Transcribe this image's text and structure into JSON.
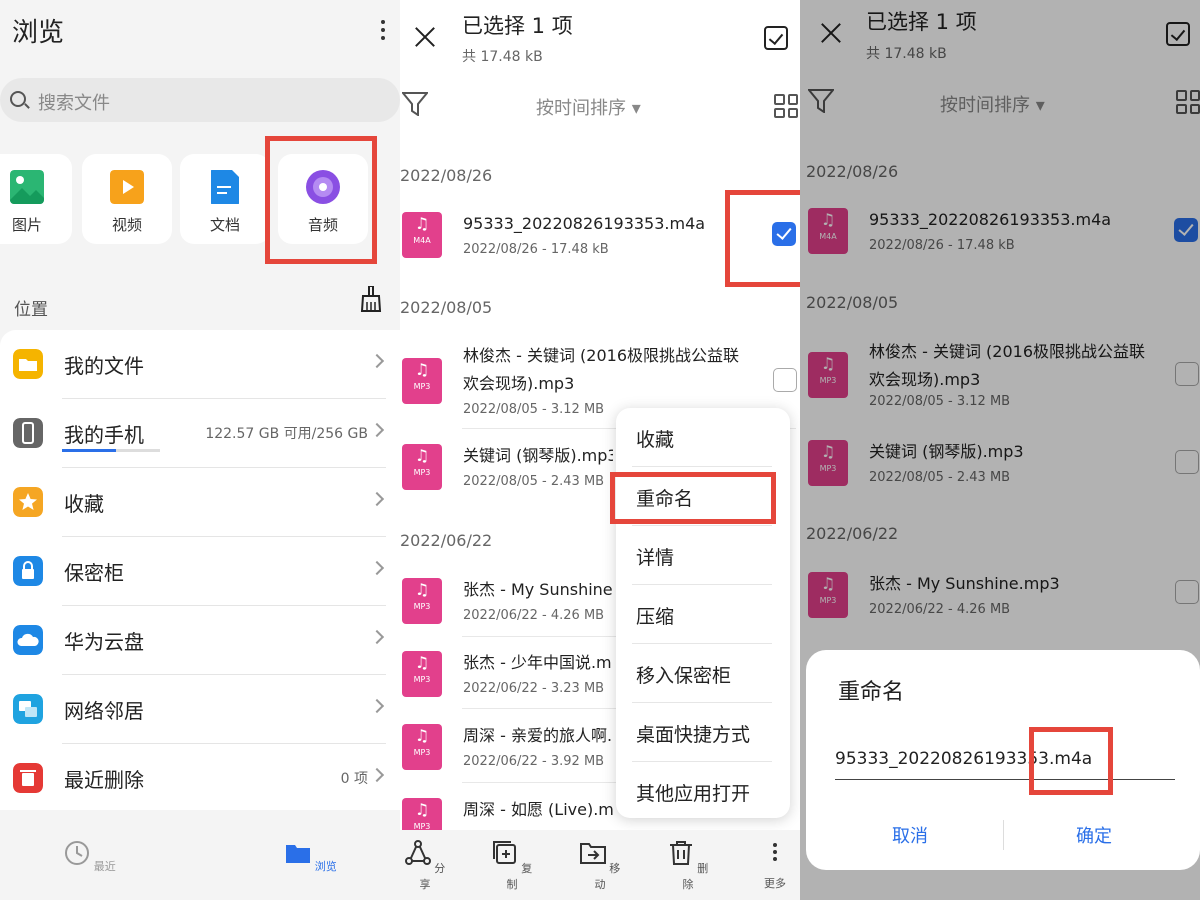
{
  "browse": {
    "title": "浏览",
    "search_placeholder": "搜索文件",
    "categories": [
      {
        "label": "图片",
        "icon": "image-icon",
        "color": "#2bb673"
      },
      {
        "label": "视频",
        "icon": "video-icon",
        "color": "#f7a21b"
      },
      {
        "label": "文档",
        "icon": "document-icon",
        "color": "#1e88e5"
      },
      {
        "label": "音频",
        "icon": "audio-icon",
        "color": "#8a4fe3"
      }
    ],
    "location_label": "位置",
    "locations": [
      {
        "label": "我的文件",
        "meta": "",
        "icon": "folder-icon",
        "color": "#f5b400"
      },
      {
        "label": "我的手机",
        "meta": "122.57 GB 可用/256 GB",
        "icon": "phone-icon",
        "color": "#666666"
      },
      {
        "label": "收藏",
        "meta": "",
        "icon": "star-icon",
        "color": "#f5a623"
      },
      {
        "label": "保密柜",
        "meta": "",
        "icon": "lock-icon",
        "color": "#1e88e5"
      },
      {
        "label": "华为云盘",
        "meta": "",
        "icon": "cloud-icon",
        "color": "#1e88e5"
      },
      {
        "label": "网络邻居",
        "meta": "",
        "icon": "network-icon",
        "color": "#1fa3e0"
      },
      {
        "label": "最近删除",
        "meta": "0 项",
        "icon": "trash-icon",
        "color": "#e53935"
      }
    ],
    "storage_fraction": 0.55,
    "nav": [
      {
        "label": "最近",
        "icon": "clock-icon",
        "active": false
      },
      {
        "label": "浏览",
        "icon": "folder-icon",
        "active": true
      }
    ]
  },
  "selection": {
    "title": "已选择 1 项",
    "subtitle": "共 17.48 kB",
    "sort_label": "按时间排序",
    "groups": [
      {
        "date": "2022/08/26",
        "files": [
          {
            "name": "95333_20220826193353.m4a",
            "info": "2022/08/26 - 17.48 kB",
            "ext": "M4A",
            "checked": true
          }
        ]
      },
      {
        "date": "2022/08/05",
        "files": [
          {
            "name": "林俊杰 - 关键词 (2016极限挑战公益联欢会现场).mp3",
            "info": "2022/08/05 - 3.12 MB",
            "ext": "MP3",
            "checked": false
          },
          {
            "name": "关键词 (钢琴版).mp3",
            "info": "2022/08/05 - 2.43 MB",
            "ext": "MP3",
            "checked": false
          }
        ]
      },
      {
        "date": "2022/06/22",
        "files": [
          {
            "name": "张杰 - My Sunshine.mp3",
            "info": "2022/06/22 - 4.26 MB",
            "ext": "MP3",
            "checked": false
          },
          {
            "name": "张杰 - 少年中国说.mp3",
            "info": "2022/06/22 - 3.23 MB",
            "ext": "MP3",
            "checked": false
          },
          {
            "name": "周深 - 亲爱的旅人啊.mp3",
            "info": "2022/06/22 - 3.92 MB",
            "ext": "MP3",
            "checked": false
          },
          {
            "name": "周深 - 如愿 (Live).mp3",
            "info": "",
            "ext": "MP3",
            "checked": false
          }
        ]
      }
    ],
    "menu": [
      "收藏",
      "重命名",
      "详情",
      "压缩",
      "移入保密柜",
      "桌面快捷方式",
      "其他应用打开"
    ],
    "toolbar": [
      {
        "label": "分享",
        "icon": "share-icon"
      },
      {
        "label": "复制",
        "icon": "copy-icon"
      },
      {
        "label": "移动",
        "icon": "move-icon"
      },
      {
        "label": "删除",
        "icon": "delete-icon"
      },
      {
        "label": "更多",
        "icon": "more-icon"
      }
    ]
  },
  "rename_dialog": {
    "title": "重命名",
    "value": "95333_20220826193353.m4a",
    "cancel_label": "取消",
    "confirm_label": "确定"
  },
  "colors": {
    "accent": "#2a6fe8",
    "highlight_box": "#e5463b",
    "audio_file": "#e2408c"
  }
}
